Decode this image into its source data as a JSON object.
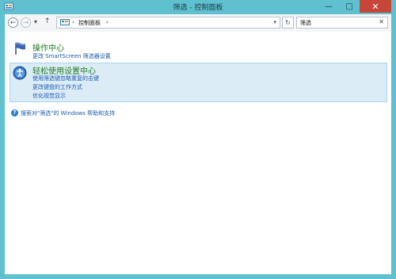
{
  "window": {
    "title": "筛选 - 控制面板",
    "minimize_glyph": "—",
    "maximize_glyph": "□",
    "close_glyph": "✕"
  },
  "nav": {
    "back_glyph": "←",
    "forward_glyph": "→",
    "recent_glyph": "▾",
    "up_glyph": "↑",
    "breadcrumb": [
      "控制面板"
    ],
    "breadcrumb_sep": "›",
    "address_dropdown_glyph": "▾",
    "refresh_glyph": "↻",
    "search_value": "筛选",
    "search_clear_glyph": "✕"
  },
  "results": [
    {
      "title": "操作中心",
      "links": [
        "更改 SmartScreen 筛选器设置"
      ],
      "highlighted": false
    },
    {
      "title": "轻松使用设置中心",
      "links": [
        "使用筛选键忽略重复的击键",
        "更改键盘的工作方式",
        "优化视觉显示"
      ],
      "highlighted": true
    }
  ],
  "help": {
    "icon_glyph": "?",
    "text": "搜索对\"筛选\"的 Windows 帮助和支持"
  },
  "colors": {
    "frame": "#5fc0cf",
    "close_button": "#c7463a",
    "result_title": "#1e7c1e",
    "link": "#1b59b0",
    "highlight_bg": "#dcecf7",
    "highlight_border": "#a9d2ee"
  }
}
